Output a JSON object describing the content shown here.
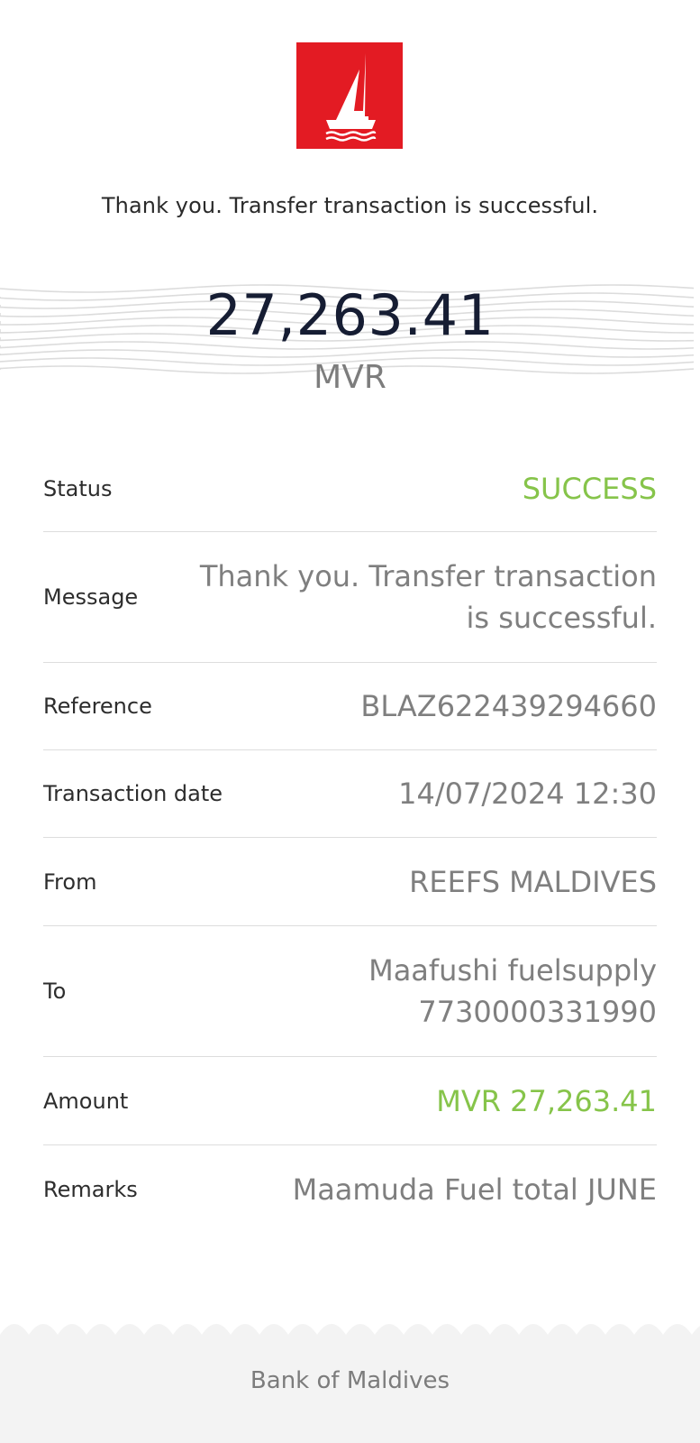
{
  "header": {
    "logo_icon": "sailboat-logo-icon",
    "logo_color": "#e31b23",
    "message": "Thank you. Transfer transaction is successful."
  },
  "summary": {
    "amount": "27,263.41",
    "currency": "MVR"
  },
  "details": {
    "status": {
      "label": "Status",
      "value": "SUCCESS",
      "color": "#86c44a"
    },
    "message": {
      "label": "Message",
      "value": "Thank you. Transfer transaction is successful."
    },
    "reference": {
      "label": "Reference",
      "value": "BLAZ622439294660"
    },
    "transaction_date": {
      "label": "Transaction date",
      "value": "14/07/2024 12:30"
    },
    "from": {
      "label": "From",
      "value": "REEFS MALDIVES"
    },
    "to": {
      "label": "To",
      "name": "Maafushi fuelsupply",
      "account": "7730000331990"
    },
    "amount": {
      "label": "Amount",
      "value": "MVR 27,263.41",
      "color": "#86c44a"
    },
    "remarks": {
      "label": "Remarks",
      "value": "Maamuda Fuel total JUNE"
    }
  },
  "footer": {
    "bank_name": "Bank of Maldives"
  }
}
